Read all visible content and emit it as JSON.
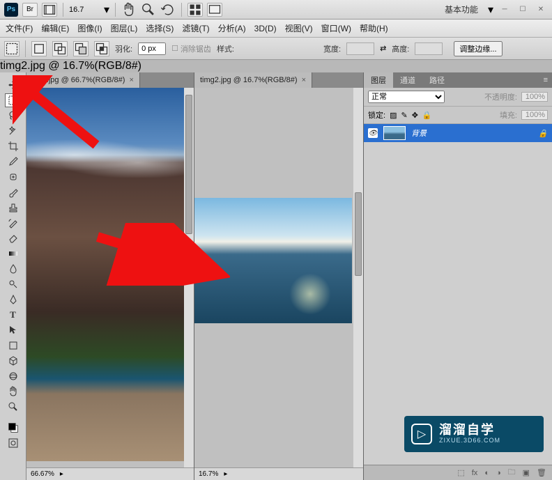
{
  "app": {
    "ps_label": "Ps",
    "br_label": "Br",
    "zoom_display": "16.7"
  },
  "titlebar": {
    "workspace": "基本功能"
  },
  "menu": {
    "file": "文件(F)",
    "edit": "编辑(E)",
    "image": "图像(I)",
    "layer": "图层(L)",
    "select": "选择(S)",
    "filter": "滤镜(T)",
    "analyze": "分析(A)",
    "threed": "3D(D)",
    "view": "视图(V)",
    "window": "窗口(W)",
    "help": "帮助(H)"
  },
  "options": {
    "feather_label": "羽化:",
    "feather_value": "0 px",
    "antialias": "消除锯齿",
    "style_label": "样式:",
    "width_label": "宽度:",
    "height_label": "高度:",
    "refine_edge": "调整边缘..."
  },
  "tooltip": "timg2.jpg @ 16.7%(RGB/8#)",
  "docs": {
    "tab1": "timg.jpg @ 66.7%(RGB/8#)",
    "tab2": "timg2.jpg @ 16.7%(RGB/8#)"
  },
  "status": {
    "zoom1": "66.67%",
    "zoom2": "16.7%"
  },
  "panels": {
    "layers_tab": "图层",
    "channels_tab": "通道",
    "paths_tab": "路径",
    "blend_mode": "正常",
    "opacity_label": "不透明度:",
    "opacity_val": "100%",
    "lock_label": "锁定:",
    "fill_label": "填充:",
    "fill_val": "100%",
    "bg_layer": "背景"
  },
  "watermark": {
    "title": "溜溜自学",
    "url": "ZIXUE.3D66.COM"
  }
}
